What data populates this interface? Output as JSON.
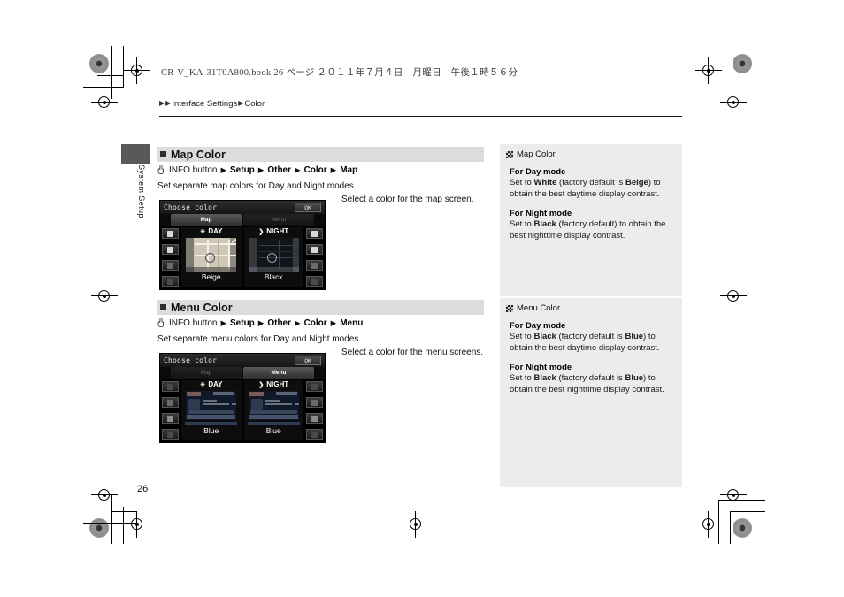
{
  "document": {
    "meta_line": "CR-V_KA-31T0A800.book  26 ページ  ２０１１年７月４日　月曜日　午後１時５６分",
    "page_number": "26",
    "side_tab": "System Setup"
  },
  "breadcrumb": {
    "arrow": "▶",
    "level1": "Interface Settings",
    "level2": "Color"
  },
  "sections": [
    {
      "id": "map-color",
      "title": "Map Color",
      "nav_path": {
        "hand_icon": "hand-press-icon",
        "start": "INFO button",
        "steps": [
          "Setup",
          "Other",
          "Color",
          "Map"
        ],
        "arrow": "▶"
      },
      "description": "Set separate map colors for Day and Night modes.",
      "caption": "Select a color for the map screen.",
      "screen": {
        "title": "Choose color",
        "ok_label": "OK",
        "tabs": [
          {
            "label": "Map",
            "selected": true
          },
          {
            "label": "Menu",
            "selected": false
          }
        ],
        "panes": [
          {
            "mode": "DAY",
            "glyph": "☀",
            "color_name": "Beige",
            "thumb": "map-day"
          },
          {
            "mode": "NIGHT",
            "glyph": "❯",
            "color_name": "Black",
            "thumb": "map-night"
          }
        ]
      }
    },
    {
      "id": "menu-color",
      "title": "Menu Color",
      "nav_path": {
        "hand_icon": "hand-press-icon",
        "start": "INFO button",
        "steps": [
          "Setup",
          "Other",
          "Color",
          "Menu"
        ],
        "arrow": "▶"
      },
      "description": "Set separate menu colors for Day and Night modes.",
      "caption": "Select a color for the menu screens.",
      "screen": {
        "title": "Choose color",
        "ok_label": "OK",
        "tabs": [
          {
            "label": "Map",
            "selected": false
          },
          {
            "label": "Menu",
            "selected": true
          }
        ],
        "panes": [
          {
            "mode": "DAY",
            "glyph": "☀",
            "color_name": "Blue",
            "thumb": "menu"
          },
          {
            "mode": "NIGHT",
            "glyph": "❯",
            "color_name": "Blue",
            "thumb": "menu"
          }
        ]
      }
    }
  ],
  "info_notes": [
    {
      "id": "map-color-note",
      "marker_icon": "halftone-square-icon",
      "title": "Map Color",
      "blocks": [
        {
          "heading": "For Day mode",
          "text_parts": [
            "Set to ",
            "White",
            " (factory default is ",
            "Beige",
            ") to obtain the best daytime display contrast."
          ]
        },
        {
          "heading": "For Night mode",
          "text_parts": [
            "Set to ",
            "Black",
            " (factory default) to obtain the best nighttime display contrast."
          ]
        }
      ]
    },
    {
      "id": "menu-color-note",
      "marker_icon": "halftone-square-icon",
      "title": "Menu Color",
      "blocks": [
        {
          "heading": "For Day mode",
          "text_parts": [
            "Set to ",
            "Black",
            " (factory default is ",
            "Blue",
            ") to obtain the best daytime display contrast."
          ]
        },
        {
          "heading": "For Night mode",
          "text_parts": [
            "Set to ",
            "Black",
            " (factory default is ",
            "Blue",
            ") to obtain the best nighttime display contrast."
          ]
        }
      ]
    }
  ],
  "colors": {
    "section_bar": "#dcdcdc",
    "info_panel": "#ececec",
    "screen_bg": "#000000"
  }
}
